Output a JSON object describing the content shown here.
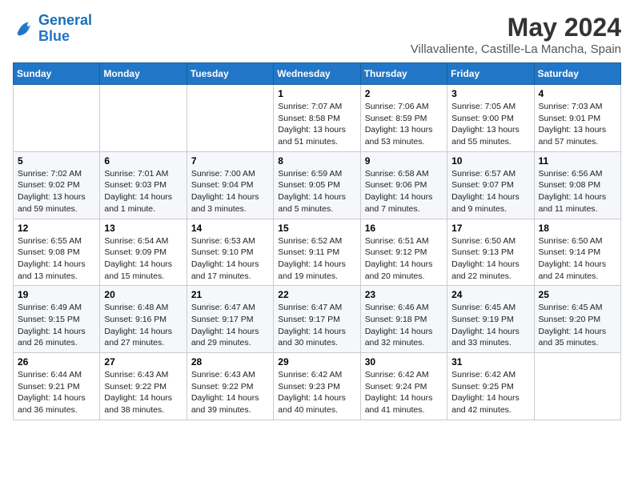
{
  "header": {
    "logo_general": "General",
    "logo_blue": "Blue",
    "month_title": "May 2024",
    "location": "Villavaliente, Castille-La Mancha, Spain"
  },
  "columns": [
    "Sunday",
    "Monday",
    "Tuesday",
    "Wednesday",
    "Thursday",
    "Friday",
    "Saturday"
  ],
  "weeks": [
    [
      {
        "day": "",
        "sunrise": "",
        "sunset": "",
        "daylight": ""
      },
      {
        "day": "",
        "sunrise": "",
        "sunset": "",
        "daylight": ""
      },
      {
        "day": "",
        "sunrise": "",
        "sunset": "",
        "daylight": ""
      },
      {
        "day": "1",
        "sunrise": "Sunrise: 7:07 AM",
        "sunset": "Sunset: 8:58 PM",
        "daylight": "Daylight: 13 hours and 51 minutes."
      },
      {
        "day": "2",
        "sunrise": "Sunrise: 7:06 AM",
        "sunset": "Sunset: 8:59 PM",
        "daylight": "Daylight: 13 hours and 53 minutes."
      },
      {
        "day": "3",
        "sunrise": "Sunrise: 7:05 AM",
        "sunset": "Sunset: 9:00 PM",
        "daylight": "Daylight: 13 hours and 55 minutes."
      },
      {
        "day": "4",
        "sunrise": "Sunrise: 7:03 AM",
        "sunset": "Sunset: 9:01 PM",
        "daylight": "Daylight: 13 hours and 57 minutes."
      }
    ],
    [
      {
        "day": "5",
        "sunrise": "Sunrise: 7:02 AM",
        "sunset": "Sunset: 9:02 PM",
        "daylight": "Daylight: 13 hours and 59 minutes."
      },
      {
        "day": "6",
        "sunrise": "Sunrise: 7:01 AM",
        "sunset": "Sunset: 9:03 PM",
        "daylight": "Daylight: 14 hours and 1 minute."
      },
      {
        "day": "7",
        "sunrise": "Sunrise: 7:00 AM",
        "sunset": "Sunset: 9:04 PM",
        "daylight": "Daylight: 14 hours and 3 minutes."
      },
      {
        "day": "8",
        "sunrise": "Sunrise: 6:59 AM",
        "sunset": "Sunset: 9:05 PM",
        "daylight": "Daylight: 14 hours and 5 minutes."
      },
      {
        "day": "9",
        "sunrise": "Sunrise: 6:58 AM",
        "sunset": "Sunset: 9:06 PM",
        "daylight": "Daylight: 14 hours and 7 minutes."
      },
      {
        "day": "10",
        "sunrise": "Sunrise: 6:57 AM",
        "sunset": "Sunset: 9:07 PM",
        "daylight": "Daylight: 14 hours and 9 minutes."
      },
      {
        "day": "11",
        "sunrise": "Sunrise: 6:56 AM",
        "sunset": "Sunset: 9:08 PM",
        "daylight": "Daylight: 14 hours and 11 minutes."
      }
    ],
    [
      {
        "day": "12",
        "sunrise": "Sunrise: 6:55 AM",
        "sunset": "Sunset: 9:08 PM",
        "daylight": "Daylight: 14 hours and 13 minutes."
      },
      {
        "day": "13",
        "sunrise": "Sunrise: 6:54 AM",
        "sunset": "Sunset: 9:09 PM",
        "daylight": "Daylight: 14 hours and 15 minutes."
      },
      {
        "day": "14",
        "sunrise": "Sunrise: 6:53 AM",
        "sunset": "Sunset: 9:10 PM",
        "daylight": "Daylight: 14 hours and 17 minutes."
      },
      {
        "day": "15",
        "sunrise": "Sunrise: 6:52 AM",
        "sunset": "Sunset: 9:11 PM",
        "daylight": "Daylight: 14 hours and 19 minutes."
      },
      {
        "day": "16",
        "sunrise": "Sunrise: 6:51 AM",
        "sunset": "Sunset: 9:12 PM",
        "daylight": "Daylight: 14 hours and 20 minutes."
      },
      {
        "day": "17",
        "sunrise": "Sunrise: 6:50 AM",
        "sunset": "Sunset: 9:13 PM",
        "daylight": "Daylight: 14 hours and 22 minutes."
      },
      {
        "day": "18",
        "sunrise": "Sunrise: 6:50 AM",
        "sunset": "Sunset: 9:14 PM",
        "daylight": "Daylight: 14 hours and 24 minutes."
      }
    ],
    [
      {
        "day": "19",
        "sunrise": "Sunrise: 6:49 AM",
        "sunset": "Sunset: 9:15 PM",
        "daylight": "Daylight: 14 hours and 26 minutes."
      },
      {
        "day": "20",
        "sunrise": "Sunrise: 6:48 AM",
        "sunset": "Sunset: 9:16 PM",
        "daylight": "Daylight: 14 hours and 27 minutes."
      },
      {
        "day": "21",
        "sunrise": "Sunrise: 6:47 AM",
        "sunset": "Sunset: 9:17 PM",
        "daylight": "Daylight: 14 hours and 29 minutes."
      },
      {
        "day": "22",
        "sunrise": "Sunrise: 6:47 AM",
        "sunset": "Sunset: 9:17 PM",
        "daylight": "Daylight: 14 hours and 30 minutes."
      },
      {
        "day": "23",
        "sunrise": "Sunrise: 6:46 AM",
        "sunset": "Sunset: 9:18 PM",
        "daylight": "Daylight: 14 hours and 32 minutes."
      },
      {
        "day": "24",
        "sunrise": "Sunrise: 6:45 AM",
        "sunset": "Sunset: 9:19 PM",
        "daylight": "Daylight: 14 hours and 33 minutes."
      },
      {
        "day": "25",
        "sunrise": "Sunrise: 6:45 AM",
        "sunset": "Sunset: 9:20 PM",
        "daylight": "Daylight: 14 hours and 35 minutes."
      }
    ],
    [
      {
        "day": "26",
        "sunrise": "Sunrise: 6:44 AM",
        "sunset": "Sunset: 9:21 PM",
        "daylight": "Daylight: 14 hours and 36 minutes."
      },
      {
        "day": "27",
        "sunrise": "Sunrise: 6:43 AM",
        "sunset": "Sunset: 9:22 PM",
        "daylight": "Daylight: 14 hours and 38 minutes."
      },
      {
        "day": "28",
        "sunrise": "Sunrise: 6:43 AM",
        "sunset": "Sunset: 9:22 PM",
        "daylight": "Daylight: 14 hours and 39 minutes."
      },
      {
        "day": "29",
        "sunrise": "Sunrise: 6:42 AM",
        "sunset": "Sunset: 9:23 PM",
        "daylight": "Daylight: 14 hours and 40 minutes."
      },
      {
        "day": "30",
        "sunrise": "Sunrise: 6:42 AM",
        "sunset": "Sunset: 9:24 PM",
        "daylight": "Daylight: 14 hours and 41 minutes."
      },
      {
        "day": "31",
        "sunrise": "Sunrise: 6:42 AM",
        "sunset": "Sunset: 9:25 PM",
        "daylight": "Daylight: 14 hours and 42 minutes."
      },
      {
        "day": "",
        "sunrise": "",
        "sunset": "",
        "daylight": ""
      }
    ]
  ]
}
